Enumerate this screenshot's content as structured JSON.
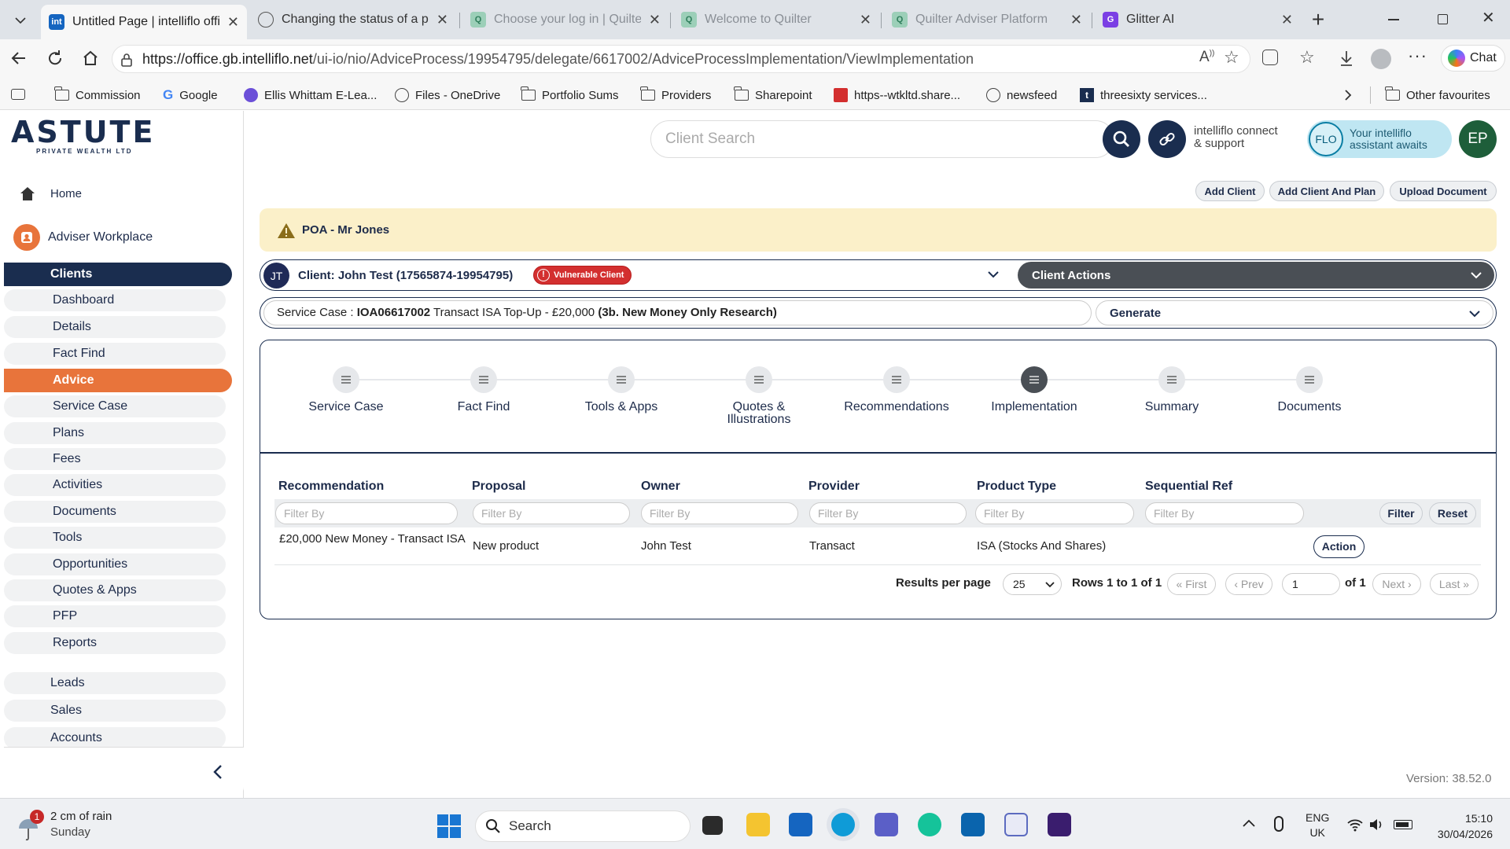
{
  "browser": {
    "tabs": [
      {
        "title": "Untitled Page | intelliflo office",
        "active": true
      },
      {
        "title": "Changing the status of a plan"
      },
      {
        "title": "Choose your log in | Quilter"
      },
      {
        "title": "Welcome to Quilter"
      },
      {
        "title": "Quilter Adviser Platform"
      },
      {
        "title": "Glitter AI"
      }
    ],
    "url_host": "https://office.gb.intelliflo.net",
    "url_path": "/ui-io/nio/AdviceProcess/19954795/delegate/6617002/AdviceProcessImplementation/ViewImplementation",
    "chat_label": "Chat",
    "bookmarks": [
      "Commission",
      "Google",
      "Ellis Whittam E-Lea...",
      "Files - OneDrive",
      "Portfolio Sums",
      "Providers",
      "Sharepoint",
      "https--wtkltd.share...",
      "newsfeed",
      "threesixty services..."
    ],
    "other_favourites": "Other favourites"
  },
  "header": {
    "logo_text": "ASTUTE",
    "logo_sub": "PRIVATE WEALTH LTD",
    "search_placeholder": "Client Search",
    "connect_label_1": "intelliflo connect",
    "connect_label_2": "& support",
    "flo_label_1": "Your intelliflo",
    "flo_label_2": "assistant awaits",
    "flo_badge": "FLO",
    "avatar_initials": "EP",
    "actions": [
      "Add Client",
      "Add Client And Plan",
      "Upload Document"
    ]
  },
  "sidebar": {
    "home": "Home",
    "workplace": "Adviser Workplace",
    "items": [
      "Clients",
      "Dashboard",
      "Details",
      "Fact Find",
      "Advice",
      "Service Case",
      "Plans",
      "Fees",
      "Activities",
      "Documents",
      "Tools",
      "Opportunities",
      "Quotes & Apps",
      "PFP",
      "Reports"
    ],
    "bottom": [
      "Leads",
      "Sales",
      "Accounts"
    ]
  },
  "alert": {
    "text": "POA - Mr Jones"
  },
  "client": {
    "initials": "JT",
    "label": "Client: John Test (17565874-19954795)",
    "badge": "Vulnerable Client",
    "actions_label": "Client Actions"
  },
  "service_case": {
    "prefix": "Service Case :",
    "ref": "IOA06617002",
    "desc": "Transact ISA Top-Up - £20,000",
    "type": "(3b. New Money Only Research)",
    "generate_label": "Generate"
  },
  "steps": [
    "Service Case",
    "Fact Find",
    "Tools & Apps",
    "Quotes & Illustrations",
    "Recommendations",
    "Implementation",
    "Summary",
    "Documents"
  ],
  "active_step": "Implementation",
  "table": {
    "columns": [
      "Recommendation",
      "Proposal",
      "Owner",
      "Provider",
      "Product Type",
      "Sequential Ref"
    ],
    "filter_placeholder": "Filter By",
    "filter_button": "Filter",
    "reset_button": "Reset",
    "rows": [
      {
        "recommendation": "£20,000 New Money - Transact ISA",
        "proposal": "New product",
        "owner": "John Test",
        "provider": "Transact",
        "product_type": "ISA (Stocks And Shares)",
        "sequential_ref": "",
        "action": "Action"
      }
    ]
  },
  "pagination": {
    "results_label": "Results per page",
    "per_page": "25",
    "rows_label": "Rows 1 to 1 of 1",
    "first": "« First",
    "prev": "‹ Prev",
    "page": "1",
    "of": "of 1",
    "next": "Next ›",
    "last": "Last »"
  },
  "version": "Version: 38.52.0",
  "taskbar": {
    "weather_badge": "1",
    "weather_1": "2 cm of rain",
    "weather_2": "Sunday",
    "search": "Search",
    "lang_1": "ENG",
    "lang_2": "UK",
    "time": "15:10",
    "date": "30/04/2026"
  },
  "colors": {
    "navy": "#1a2d4f",
    "orange": "#e8743b",
    "alert_bg": "#fbf0c9",
    "vulnerable": "#d32f2f"
  }
}
